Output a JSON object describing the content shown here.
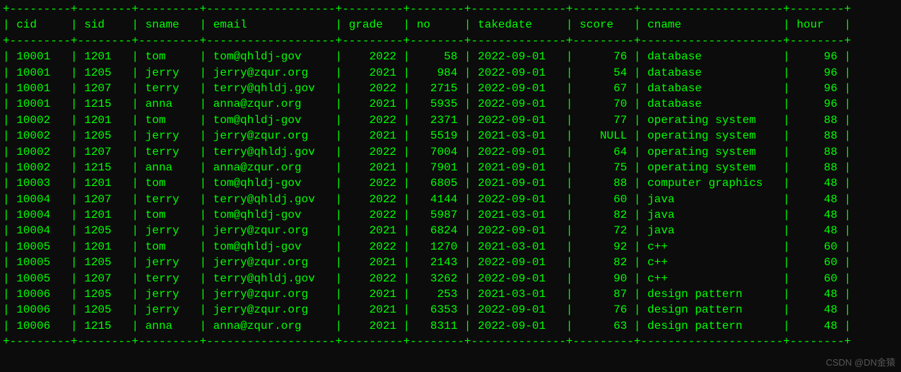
{
  "headers": [
    "cid",
    "sid",
    "sname",
    "email",
    "grade",
    "no",
    "takedate",
    "score",
    "cname",
    "hour"
  ],
  "rows": [
    {
      "cid": "10001",
      "sid": "1201",
      "sname": "tom",
      "email": "tom@qhldj-gov",
      "grade": "2022",
      "no": "58",
      "takedate": "2022-09-01",
      "score": "76",
      "cname": "database",
      "hour": "96"
    },
    {
      "cid": "10001",
      "sid": "1205",
      "sname": "jerry",
      "email": "jerry@zqur.org",
      "grade": "2021",
      "no": "984",
      "takedate": "2022-09-01",
      "score": "54",
      "cname": "database",
      "hour": "96"
    },
    {
      "cid": "10001",
      "sid": "1207",
      "sname": "terry",
      "email": "terry@qhldj.gov",
      "grade": "2022",
      "no": "2715",
      "takedate": "2022-09-01",
      "score": "67",
      "cname": "database",
      "hour": "96"
    },
    {
      "cid": "10001",
      "sid": "1215",
      "sname": "anna",
      "email": "anna@zqur.org",
      "grade": "2021",
      "no": "5935",
      "takedate": "2022-09-01",
      "score": "70",
      "cname": "database",
      "hour": "96"
    },
    {
      "cid": "10002",
      "sid": "1201",
      "sname": "tom",
      "email": "tom@qhldj-gov",
      "grade": "2022",
      "no": "2371",
      "takedate": "2022-09-01",
      "score": "77",
      "cname": "operating system",
      "hour": "88"
    },
    {
      "cid": "10002",
      "sid": "1205",
      "sname": "jerry",
      "email": "jerry@zqur.org",
      "grade": "2021",
      "no": "5519",
      "takedate": "2021-03-01",
      "score": "NULL",
      "cname": "operating system",
      "hour": "88"
    },
    {
      "cid": "10002",
      "sid": "1207",
      "sname": "terry",
      "email": "terry@qhldj.gov",
      "grade": "2022",
      "no": "7004",
      "takedate": "2022-09-01",
      "score": "64",
      "cname": "operating system",
      "hour": "88"
    },
    {
      "cid": "10002",
      "sid": "1215",
      "sname": "anna",
      "email": "anna@zqur.org",
      "grade": "2021",
      "no": "7901",
      "takedate": "2021-09-01",
      "score": "75",
      "cname": "operating system",
      "hour": "88"
    },
    {
      "cid": "10003",
      "sid": "1201",
      "sname": "tom",
      "email": "tom@qhldj-gov",
      "grade": "2022",
      "no": "6805",
      "takedate": "2021-09-01",
      "score": "88",
      "cname": "computer graphics",
      "hour": "48"
    },
    {
      "cid": "10004",
      "sid": "1207",
      "sname": "terry",
      "email": "terry@qhldj.gov",
      "grade": "2022",
      "no": "4144",
      "takedate": "2022-09-01",
      "score": "60",
      "cname": "java",
      "hour": "48"
    },
    {
      "cid": "10004",
      "sid": "1201",
      "sname": "tom",
      "email": "tom@qhldj-gov",
      "grade": "2022",
      "no": "5987",
      "takedate": "2021-03-01",
      "score": "82",
      "cname": "java",
      "hour": "48"
    },
    {
      "cid": "10004",
      "sid": "1205",
      "sname": "jerry",
      "email": "jerry@zqur.org",
      "grade": "2021",
      "no": "6824",
      "takedate": "2022-09-01",
      "score": "72",
      "cname": "java",
      "hour": "48"
    },
    {
      "cid": "10005",
      "sid": "1201",
      "sname": "tom",
      "email": "tom@qhldj-gov",
      "grade": "2022",
      "no": "1270",
      "takedate": "2021-03-01",
      "score": "92",
      "cname": "c++",
      "hour": "60"
    },
    {
      "cid": "10005",
      "sid": "1205",
      "sname": "jerry",
      "email": "jerry@zqur.org",
      "grade": "2021",
      "no": "2143",
      "takedate": "2022-09-01",
      "score": "82",
      "cname": "c++",
      "hour": "60"
    },
    {
      "cid": "10005",
      "sid": "1207",
      "sname": "terry",
      "email": "terry@qhldj.gov",
      "grade": "2022",
      "no": "3262",
      "takedate": "2022-09-01",
      "score": "90",
      "cname": "c++",
      "hour": "60"
    },
    {
      "cid": "10006",
      "sid": "1205",
      "sname": "jerry",
      "email": "jerry@zqur.org",
      "grade": "2021",
      "no": "253",
      "takedate": "2021-03-01",
      "score": "87",
      "cname": "design pattern",
      "hour": "48"
    },
    {
      "cid": "10006",
      "sid": "1205",
      "sname": "jerry",
      "email": "jerry@zqur.org",
      "grade": "2021",
      "no": "6353",
      "takedate": "2022-09-01",
      "score": "76",
      "cname": "design pattern",
      "hour": "48"
    },
    {
      "cid": "10006",
      "sid": "1215",
      "sname": "anna",
      "email": "anna@zqur.org",
      "grade": "2021",
      "no": "8311",
      "takedate": "2022-09-01",
      "score": "63",
      "cname": "design pattern",
      "hour": "48"
    }
  ],
  "col_widths": {
    "cid": 7,
    "sid": 6,
    "sname": 7,
    "email": 17,
    "grade": 7,
    "no": 6,
    "takedate": 12,
    "score": 7,
    "cname": 19,
    "hour": 6
  },
  "col_align": {
    "cid": "left",
    "sid": "left",
    "sname": "left",
    "email": "left",
    "grade": "right",
    "no": "right",
    "takedate": "left",
    "score": "right",
    "cname": "left",
    "hour": "right"
  },
  "watermark": "CSDN @DN金猿"
}
